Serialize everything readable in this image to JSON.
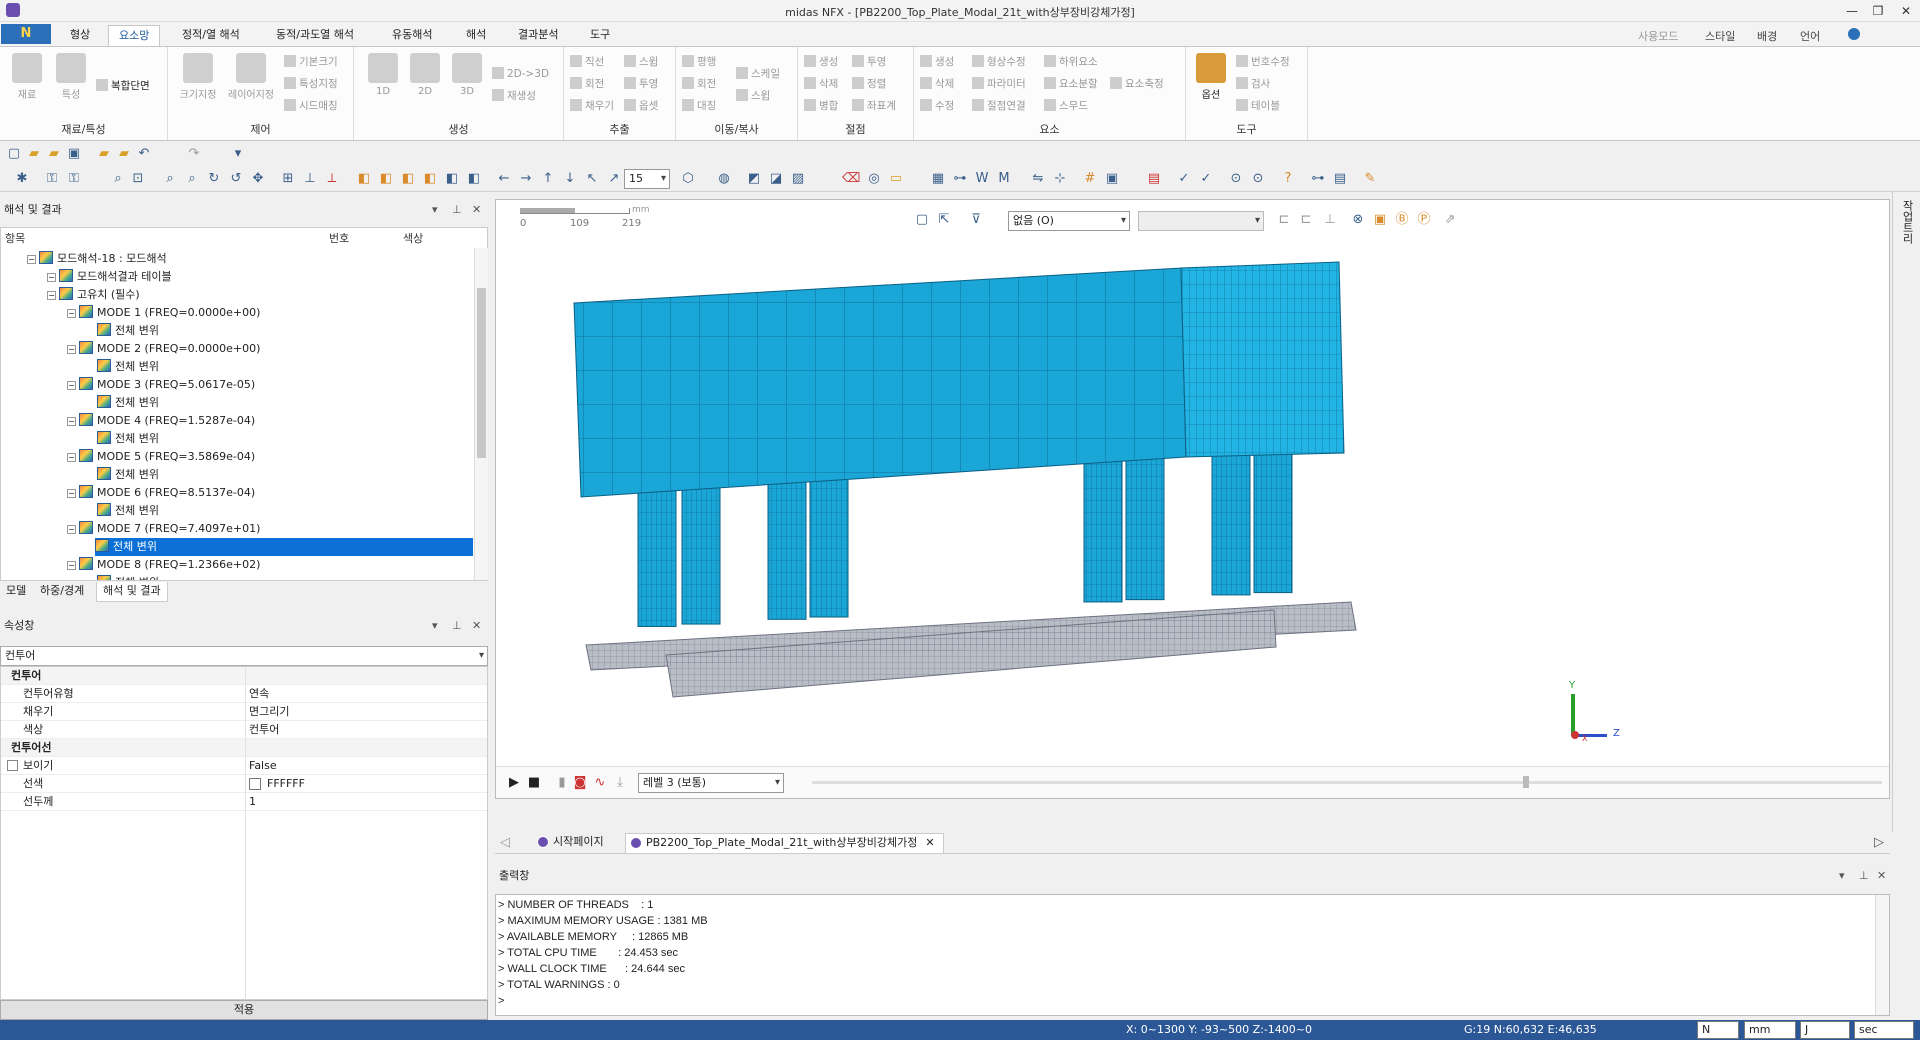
{
  "window": {
    "title": "midas NFX - [PB2200_Top_Plate_Modal_21t_with상부장비강체가정]",
    "controls": [
      "—",
      "❐",
      "✕"
    ]
  },
  "menu": {
    "app_label": "N",
    "tabs": [
      "형상",
      "요소망",
      "정적/열 해석",
      "동적/과도열 해석",
      "유동해석",
      "해석",
      "결과분석",
      "도구"
    ],
    "active_tab": "요소망",
    "right": [
      "사용모드",
      "스타일",
      "배경",
      "언어"
    ]
  },
  "ribbon": {
    "groups": [
      {
        "label": "재료/특성",
        "big": [
          "재료",
          "특성"
        ],
        "small": [
          "복합단면"
        ]
      },
      {
        "label": "제어",
        "big": [
          "크기지정",
          "레이어지정"
        ],
        "small": [
          "기본크기",
          "특성지정",
          "시드매칭"
        ]
      },
      {
        "label": "생성",
        "big": [
          "1D",
          "2D",
          "3D"
        ],
        "small": [
          "2D->3D",
          "재생성"
        ]
      },
      {
        "label": "추출",
        "small": [
          "직선",
          "회전",
          "채우기",
          "스윕",
          "투영",
          "옵셋"
        ]
      },
      {
        "label": "이동/복사",
        "small": [
          "평행",
          "회전",
          "대칭",
          "스케일",
          "스윕"
        ]
      },
      {
        "label": "절점",
        "small": [
          "생성",
          "삭제",
          "병합",
          "투영",
          "정렬",
          "좌표계"
        ]
      },
      {
        "label": "요소",
        "small": [
          "생성",
          "삭제",
          "수정",
          "형상수정",
          "파라미터",
          "절점연결",
          "하위요소",
          "요소분할",
          "스무드",
          "요소축정"
        ]
      },
      {
        "label": "도구",
        "big": [
          "옵션"
        ],
        "small": [
          "번호수정",
          "검사",
          "테이블"
        ]
      }
    ]
  },
  "toolbar": {
    "view_count": "15"
  },
  "left_panel": {
    "title": "해석 및 결과",
    "columns": [
      "항목",
      "번호",
      "색상"
    ],
    "tree": [
      {
        "label": "모드해석-18 : 모드해석",
        "level": 1
      },
      {
        "label": "모드해석결과 테이블",
        "level": 2
      },
      {
        "label": "고유치 (필수)",
        "level": 2
      },
      {
        "label": "MODE 1 (FREQ=0.0000e+00)",
        "level": 3
      },
      {
        "label": "전체 변위",
        "level": 4
      },
      {
        "label": "MODE 2 (FREQ=0.0000e+00)",
        "level": 3
      },
      {
        "label": "전체 변위",
        "level": 4
      },
      {
        "label": "MODE 3 (FREQ=5.0617e-05)",
        "level": 3
      },
      {
        "label": "전체 변위",
        "level": 4
      },
      {
        "label": "MODE 4 (FREQ=1.5287e-04)",
        "level": 3
      },
      {
        "label": "전체 변위",
        "level": 4
      },
      {
        "label": "MODE 5 (FREQ=3.5869e-04)",
        "level": 3
      },
      {
        "label": "전체 변위",
        "level": 4
      },
      {
        "label": "MODE 6 (FREQ=8.5137e-04)",
        "level": 3
      },
      {
        "label": "전체 변위",
        "level": 4
      },
      {
        "label": "MODE 7 (FREQ=7.4097e+01)",
        "level": 3
      },
      {
        "label": "전체 변위",
        "level": 4,
        "selected": true
      },
      {
        "label": "MODE 8 (FREQ=1.2366e+02)",
        "level": 3
      },
      {
        "label": "전체 변위",
        "level": 4
      }
    ],
    "bottom_tabs": [
      "모델",
      "하중/경계",
      "해석 및 결과"
    ],
    "active_bottom_tab": "해석 및 결과"
  },
  "property_panel": {
    "title": "속성창",
    "selector": "컨투어",
    "rows": [
      {
        "group": true,
        "key": "컨투어"
      },
      {
        "key": "컨투어유형",
        "value": "연속"
      },
      {
        "key": "채우기",
        "value": "면그리기"
      },
      {
        "key": "색상",
        "value": "컨투어"
      },
      {
        "group": true,
        "key": "컨투어선"
      },
      {
        "key": "보이기",
        "value": "False",
        "checkbox": true
      },
      {
        "key": "선색",
        "value": "FFFFFF",
        "swatch": true
      },
      {
        "key": "선두께",
        "value": "1"
      }
    ],
    "apply_label": "적용"
  },
  "viewport": {
    "scale_labels": [
      "0",
      "109",
      "219"
    ],
    "scale_unit": "mm",
    "display_select": "없음 (O)",
    "second_select": "",
    "level_select": "레벨 3 (보통)",
    "axis": {
      "y": "Y",
      "z": "Z",
      "x": "X"
    },
    "mesh_color": "#1aa6d6",
    "base_color": "#b9bdc6"
  },
  "doc_tabs": [
    {
      "label": "시작페이지"
    },
    {
      "label": "PB2200_Top_Plate_Modal_21t_with상부장비강체가정",
      "active": true,
      "closable": "✕"
    }
  ],
  "output": {
    "title": "출력창",
    "lines": [
      "> NUMBER OF THREADS    : 1",
      "> MAXIMUM MEMORY USAGE : 1381 MB",
      "> AVAILABLE MEMORY     : 12865 MB",
      "> TOTAL CPU TIME       : 24.453 sec",
      "> WALL CLOCK TIME      : 24.644 sec",
      "> TOTAL WARNINGS : 0",
      ">"
    ]
  },
  "status": {
    "coords": "X: 0~1300 Y: -93~500 Z:-1400~0",
    "grid": "G:19  N:60,632  E:46,635",
    "units": [
      "N",
      "mm",
      "J",
      "sec"
    ]
  },
  "right_strip_label": "작업트리"
}
